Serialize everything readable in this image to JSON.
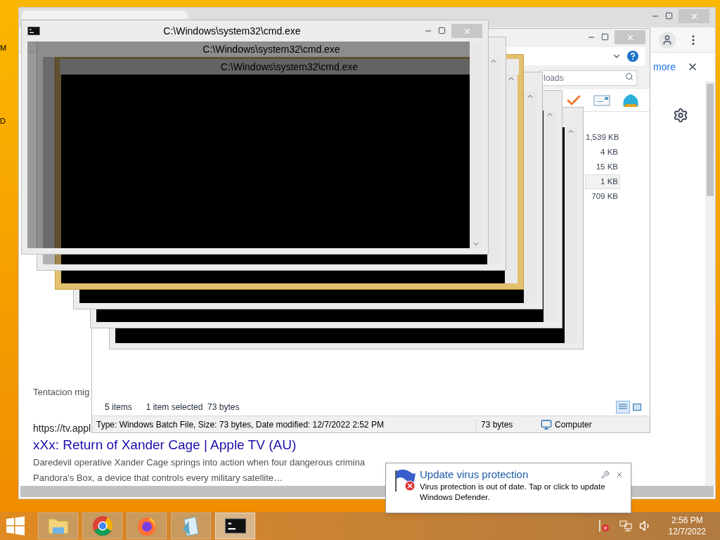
{
  "desktop": {
    "icon_labels": [
      "M",
      "D"
    ]
  },
  "browser": {
    "info_link": "more",
    "results": [
      {
        "kind": "snippet",
        "text": "Tentacion mig"
      },
      {
        "kind": "url",
        "text": "https://tv.appl"
      },
      {
        "kind": "title",
        "text": "xXx: Return of Xander Cage | Apple TV (AU)"
      },
      {
        "kind": "snippet",
        "text": "Daredevil operative Xander Cage springs into action when four dangerous crimina"
      },
      {
        "kind": "snippet",
        "text": "Pandora's Box, a device that controls every military satellite…"
      }
    ]
  },
  "explorer": {
    "search": {
      "placeholder": "loads"
    },
    "sizes": [
      {
        "text": "1,539 KB",
        "selected": false
      },
      {
        "text": "4 KB",
        "selected": false
      },
      {
        "text": "15 KB",
        "selected": false
      },
      {
        "text": "1 KB",
        "selected": true
      },
      {
        "text": "709 KB",
        "selected": false
      }
    ],
    "status": [
      "5 items",
      "1 item selected  73 bytes"
    ],
    "view_buttons": [
      {
        "kind": "details",
        "selected": true
      },
      {
        "kind": "tiles",
        "selected": false
      }
    ],
    "details": {
      "description": "Type: Windows Batch File, Size: 73 bytes, Date modified: 12/7/2022 2:52 PM",
      "size": "73 bytes",
      "location": "Computer"
    }
  },
  "cmd_window": {
    "title": "C:\\Windows\\system32\\cmd.exe"
  },
  "stacked_cmd_windows": [
    {
      "title": "C:\\Windows\\system32\\cmd.exe",
      "framed": false
    },
    {
      "title": "C:\\Windows\\system32\\cmd.exe",
      "framed": true
    },
    {
      "framed": false
    },
    {
      "framed": false
    },
    {
      "framed": false
    }
  ],
  "notification": {
    "title": "Update virus protection",
    "message": "Virus protection is out of date. Tap or click to update Windows Defender."
  },
  "taskbar": {
    "apps": [
      {
        "kind": "explorer",
        "active": false
      },
      {
        "kind": "chrome",
        "active": false
      },
      {
        "kind": "firefox",
        "active": false
      },
      {
        "kind": "notepad",
        "active": false
      },
      {
        "kind": "cmd",
        "active": true
      }
    ],
    "clock": {
      "time": "2:56 PM",
      "date": "12/7/2022"
    }
  }
}
